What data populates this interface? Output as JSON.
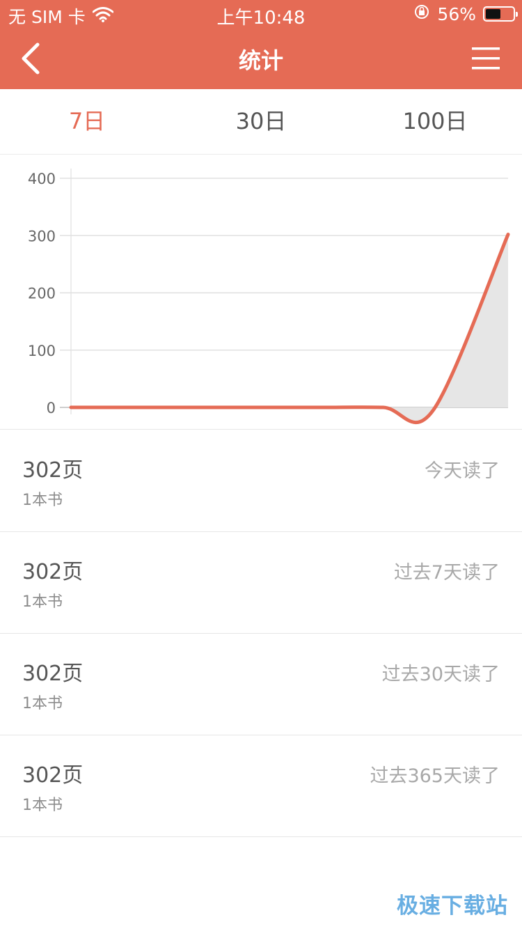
{
  "theme": {
    "accent": "#e56b55",
    "grid": "#e0e0e0",
    "fill": "#e6e6e6"
  },
  "status_bar": {
    "carrier": "无 SIM 卡",
    "wifi_icon": "wifi-icon",
    "time": "上午10:48",
    "lock_icon": "orientation-lock-icon",
    "battery_percent": "56%",
    "battery_level": 0.56
  },
  "header": {
    "title": "统计",
    "back_icon": "chevron-left-icon",
    "menu_icon": "hamburger-menu-icon"
  },
  "tabs": [
    {
      "label": "7日",
      "active": true
    },
    {
      "label": "30日",
      "active": false
    },
    {
      "label": "100日",
      "active": false
    }
  ],
  "chart_data": {
    "type": "area",
    "y_ticks": [
      "400",
      "300",
      "200",
      "100",
      "0"
    ],
    "ylim": [
      0,
      400
    ],
    "xlim": [
      0,
      7
    ],
    "points": [
      [
        0,
        0
      ],
      [
        1,
        0
      ],
      [
        2,
        0
      ],
      [
        3,
        0
      ],
      [
        4,
        0
      ],
      [
        5,
        0
      ],
      [
        5.8,
        -5
      ],
      [
        7,
        302
      ]
    ],
    "grid": true
  },
  "stats": [
    {
      "pages": "302页",
      "books": "1本书",
      "period": "今天读了"
    },
    {
      "pages": "302页",
      "books": "1本书",
      "period": "过去7天读了"
    },
    {
      "pages": "302页",
      "books": "1本书",
      "period": "过去30天读了"
    },
    {
      "pages": "302页",
      "books": "1本书",
      "period": "过去365天读了"
    }
  ],
  "watermark": "极速下载站"
}
